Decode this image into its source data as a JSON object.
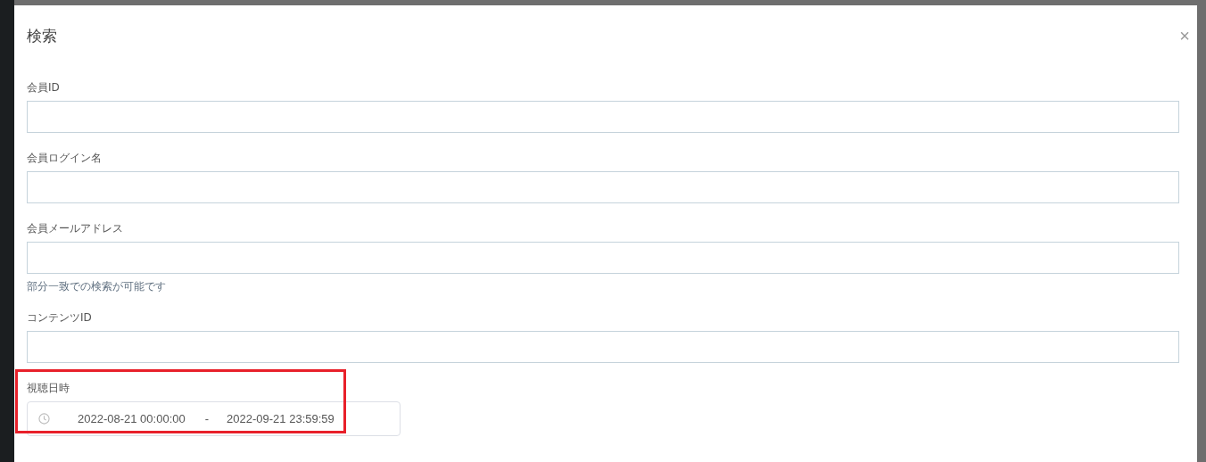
{
  "dialog": {
    "title": "検索",
    "close": "×"
  },
  "fields": [
    {
      "kind": "text",
      "label": "会員ID",
      "highlighted": false
    },
    {
      "kind": "text",
      "label": "会員ログイン名",
      "highlighted": false
    },
    {
      "kind": "text",
      "label": "会員メールアドレス",
      "hint": "部分一致での検索が可能です",
      "highlighted": false
    },
    {
      "kind": "text",
      "label": "コンテンツID",
      "highlighted": false
    },
    {
      "kind": "daterange",
      "label": "視聴日時",
      "start": "2022-08-21 00:00:00",
      "separator": "-",
      "end": "2022-09-21 23:59:59",
      "highlighted": true
    }
  ]
}
